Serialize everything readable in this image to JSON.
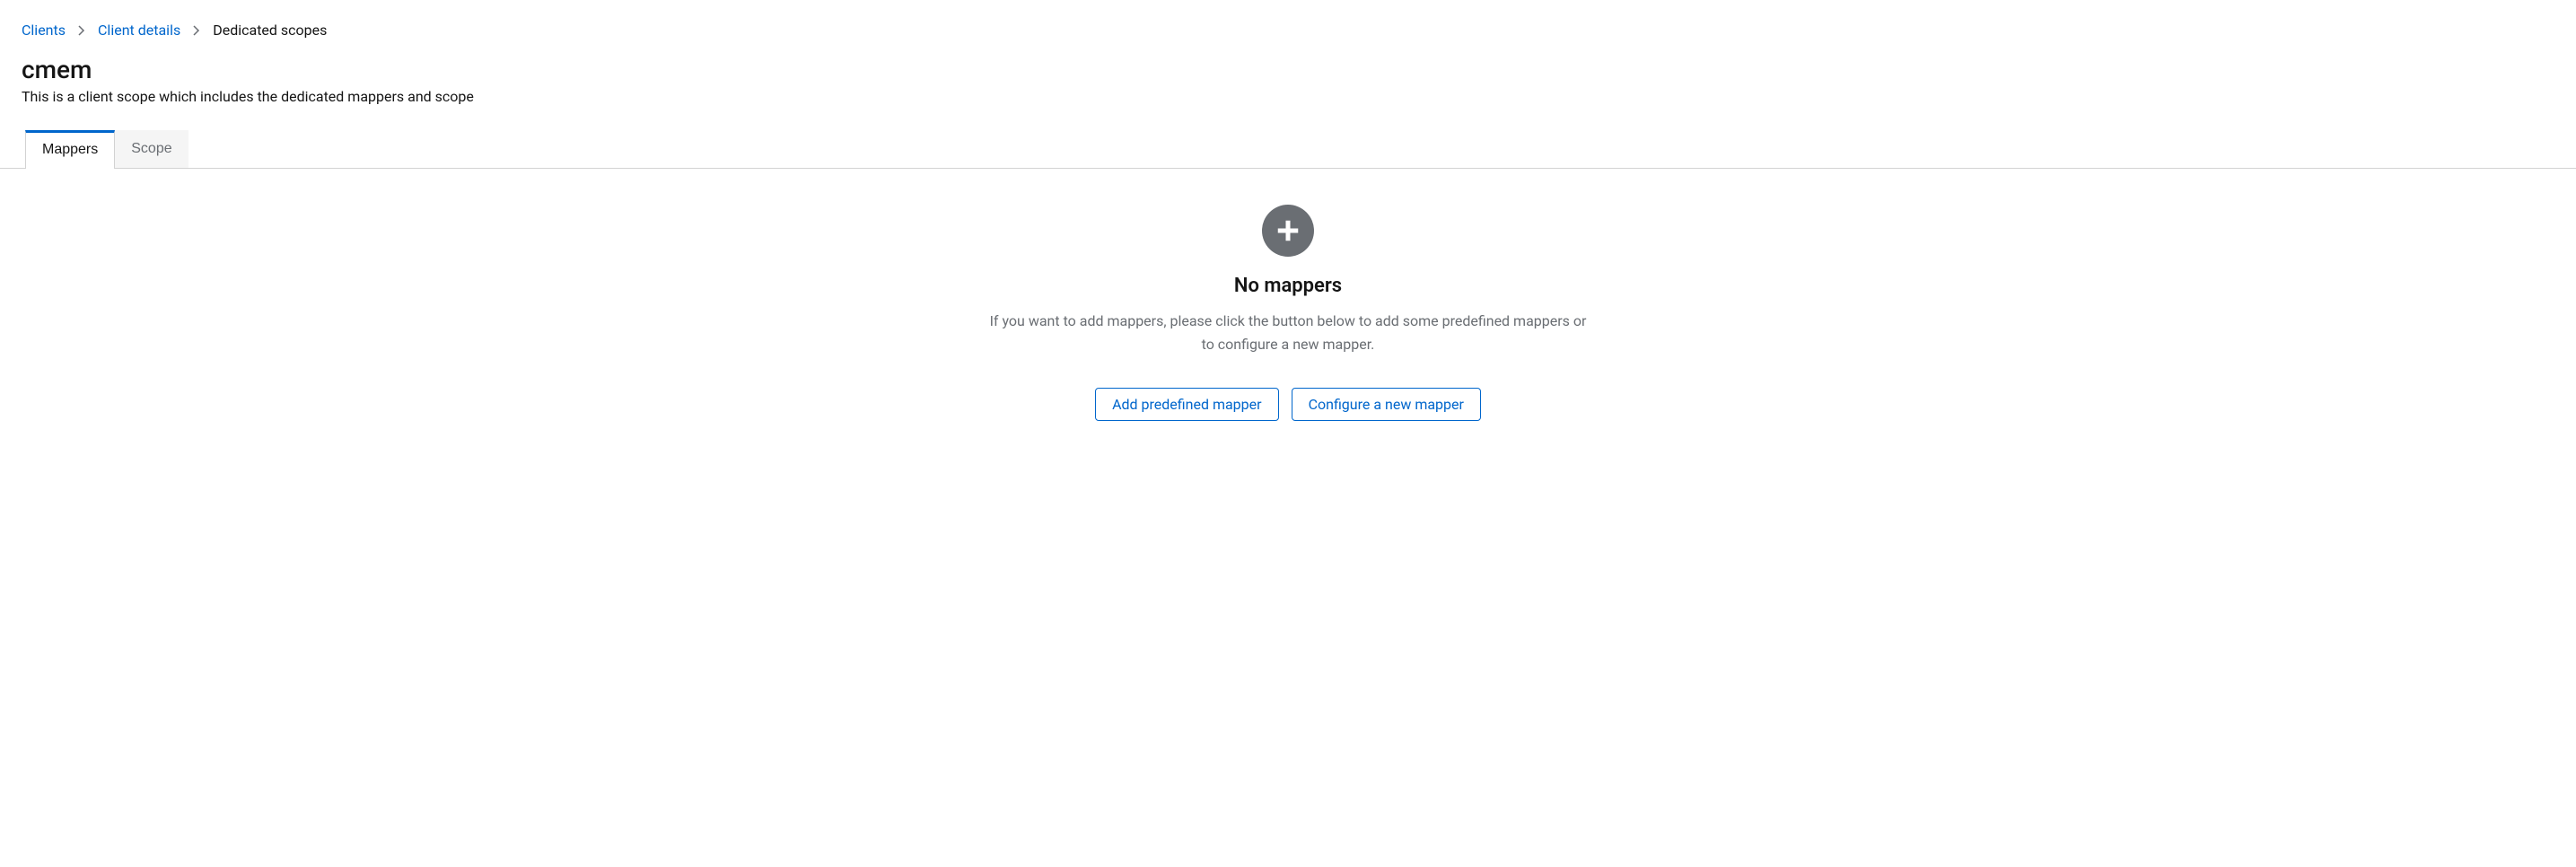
{
  "breadcrumb": {
    "items": [
      {
        "label": "Clients",
        "link": true
      },
      {
        "label": "Client details",
        "link": true
      },
      {
        "label": "Dedicated scopes",
        "link": false
      }
    ]
  },
  "header": {
    "title": "cmem",
    "subtitle": "This is a client scope which includes the dedicated mappers and scope"
  },
  "tabs": [
    {
      "label": "Mappers",
      "active": true
    },
    {
      "label": "Scope",
      "active": false
    }
  ],
  "emptyState": {
    "title": "No mappers",
    "body": "If you want to add mappers, please click the button below to add some predefined mappers or to configure a new mapper.",
    "actions": {
      "predefined": "Add predefined mapper",
      "configure": "Configure a new mapper"
    }
  }
}
